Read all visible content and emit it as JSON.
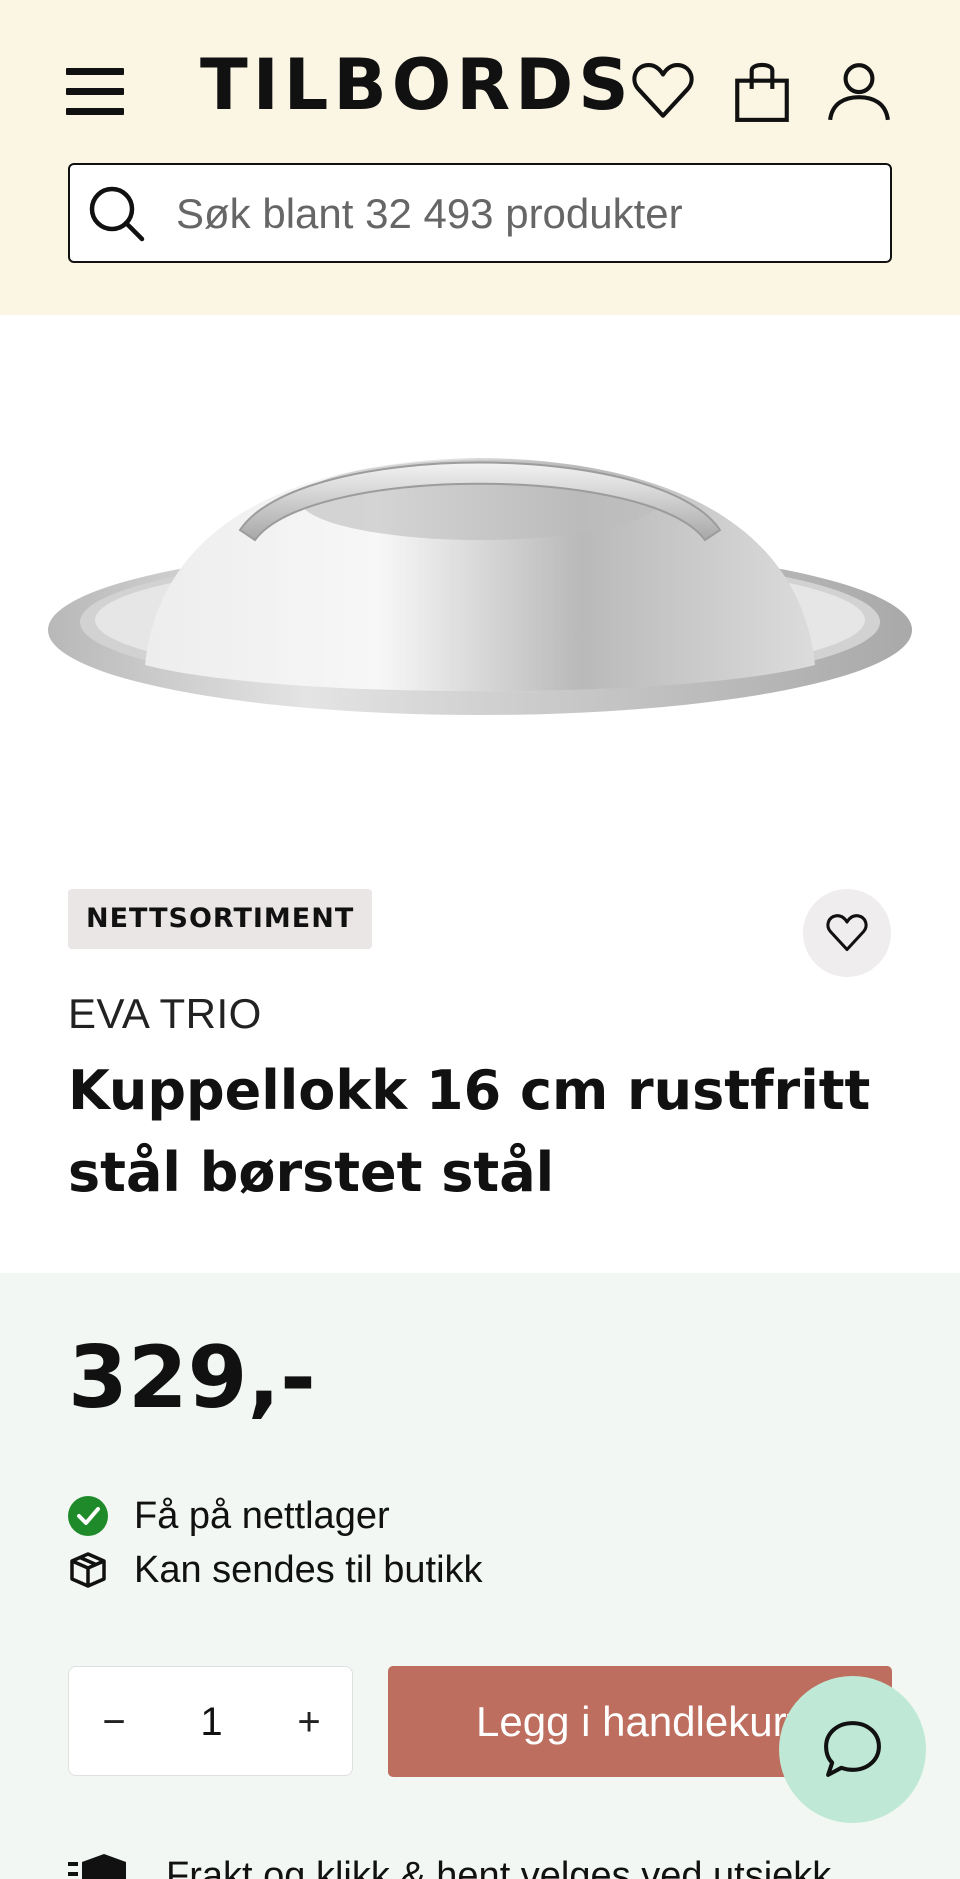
{
  "header": {
    "logo_text": "TILBORDS",
    "menu_icon": "hamburger-menu-icon",
    "icons": [
      "heart-icon",
      "shopping-bag-icon",
      "user-icon"
    ],
    "background_color": "#fbf5e4"
  },
  "search": {
    "placeholder": "Søk blant 32 493 produkter",
    "icon": "search-icon"
  },
  "product": {
    "badge": "NETTSORTIMENT",
    "brand": "EVA TRIO",
    "title": "Kuppellokk 16 cm rustfritt stål børstet stål",
    "image_icon": "dome-lid-product-image",
    "favorite_icon": "heart-icon"
  },
  "purchase": {
    "price": "329,-",
    "status": [
      {
        "icon": "check-circle-icon",
        "text": "Få på nettlager",
        "color": "#1f8a2a"
      },
      {
        "icon": "package-icon",
        "text": "Kan sendes til butikk"
      }
    ],
    "quantity": {
      "minus": "−",
      "value": "1",
      "plus": "+"
    },
    "add_to_cart_label": "Legg i handlekurv",
    "add_to_cart_color": "#bd6e5e",
    "shipping_text": "Frakt og klikk & hent velges ved utsjekk",
    "background_color": "#f2f7f3"
  },
  "chat": {
    "icon": "chat-bubble-icon",
    "color": "#bfe9d6"
  }
}
